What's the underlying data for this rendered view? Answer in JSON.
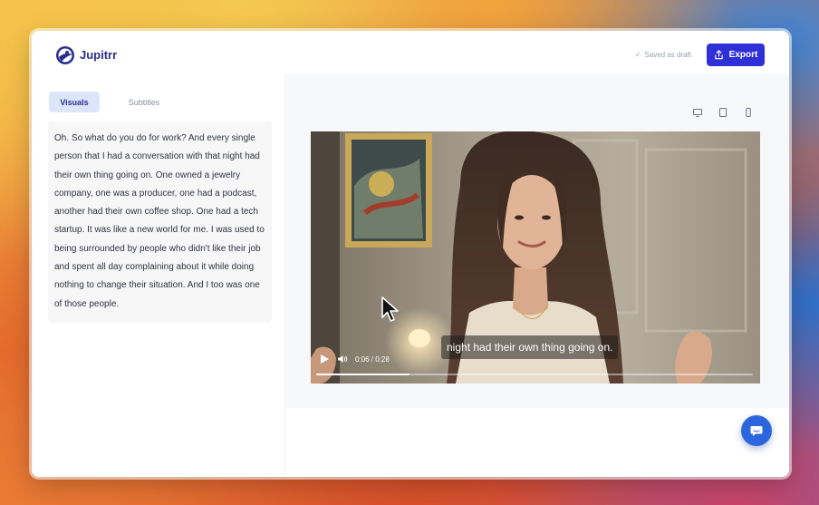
{
  "app": {
    "brand": "Jupitrr",
    "saved_status": "Saved as draft",
    "export_label": "Export"
  },
  "tabs": [
    {
      "label": "Visuals",
      "active": true
    },
    {
      "label": "Subtitles",
      "active": false
    }
  ],
  "transcript": "Oh. So what do you do for work? And every single person that I had a conversation with that night had their own thing going on. One owned a jewelry company, one was a producer, one had a podcast, another had their own coffee shop. One had a tech startup. It was like a new world for me. I was used to being surrounded by people who didn't like their job and spent all day complaining about it while doing nothing to change their situation. And I too was one of those people.",
  "player": {
    "caption": "night had their own thing going on.",
    "time_display": "0:06 / 0:28",
    "progress_fraction": 0.214
  },
  "preview_devices": [
    "desktop-icon",
    "tablet-icon",
    "mobile-icon"
  ],
  "colors": {
    "brand": "#2a2f8f",
    "accent": "#3030d8",
    "chat": "#2c66dd"
  }
}
